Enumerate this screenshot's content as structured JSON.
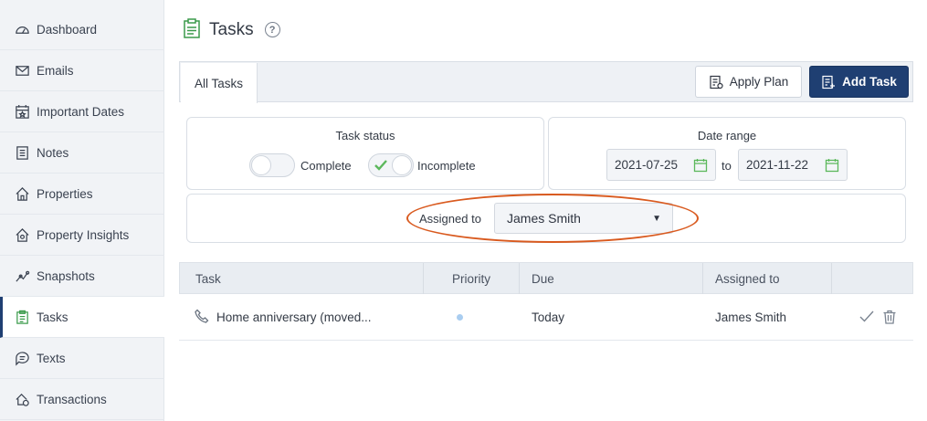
{
  "sidebar": {
    "items": [
      {
        "label": "Dashboard",
        "icon": "dashboard-icon"
      },
      {
        "label": "Emails",
        "icon": "email-icon"
      },
      {
        "label": "Important Dates",
        "icon": "calendar-star-icon"
      },
      {
        "label": "Notes",
        "icon": "notes-icon"
      },
      {
        "label": "Properties",
        "icon": "home-icon"
      },
      {
        "label": "Property Insights",
        "icon": "home-insights-icon"
      },
      {
        "label": "Snapshots",
        "icon": "snapshot-icon"
      },
      {
        "label": "Tasks",
        "icon": "clipboard-icon",
        "active": true
      },
      {
        "label": "Texts",
        "icon": "chat-icon"
      },
      {
        "label": "Transactions",
        "icon": "transactions-icon"
      }
    ]
  },
  "header": {
    "title": "Tasks",
    "help": "?"
  },
  "tabs": [
    {
      "label": "All Tasks",
      "active": true
    }
  ],
  "toolbar": {
    "apply_plan": "Apply Plan",
    "add_task": "Add Task"
  },
  "filters": {
    "status_title": "Task status",
    "complete_label": "Complete",
    "incomplete_label": "Incomplete",
    "complete_on": false,
    "incomplete_on": true,
    "date_title": "Date range",
    "date_from": "2021-07-25",
    "date_to_label": "to",
    "date_to": "2021-11-22",
    "assigned_label": "Assigned to",
    "assigned_value": "James Smith"
  },
  "table": {
    "columns": [
      "Task",
      "Priority",
      "Due",
      "Assigned to"
    ],
    "rows": [
      {
        "task": "Home anniversary (moved...",
        "priority": "low",
        "due": "Today",
        "assigned": "James Smith"
      }
    ]
  },
  "colors": {
    "accent": "#1f3f72",
    "highlight": "#d95a1f",
    "check": "#5cb85c"
  }
}
